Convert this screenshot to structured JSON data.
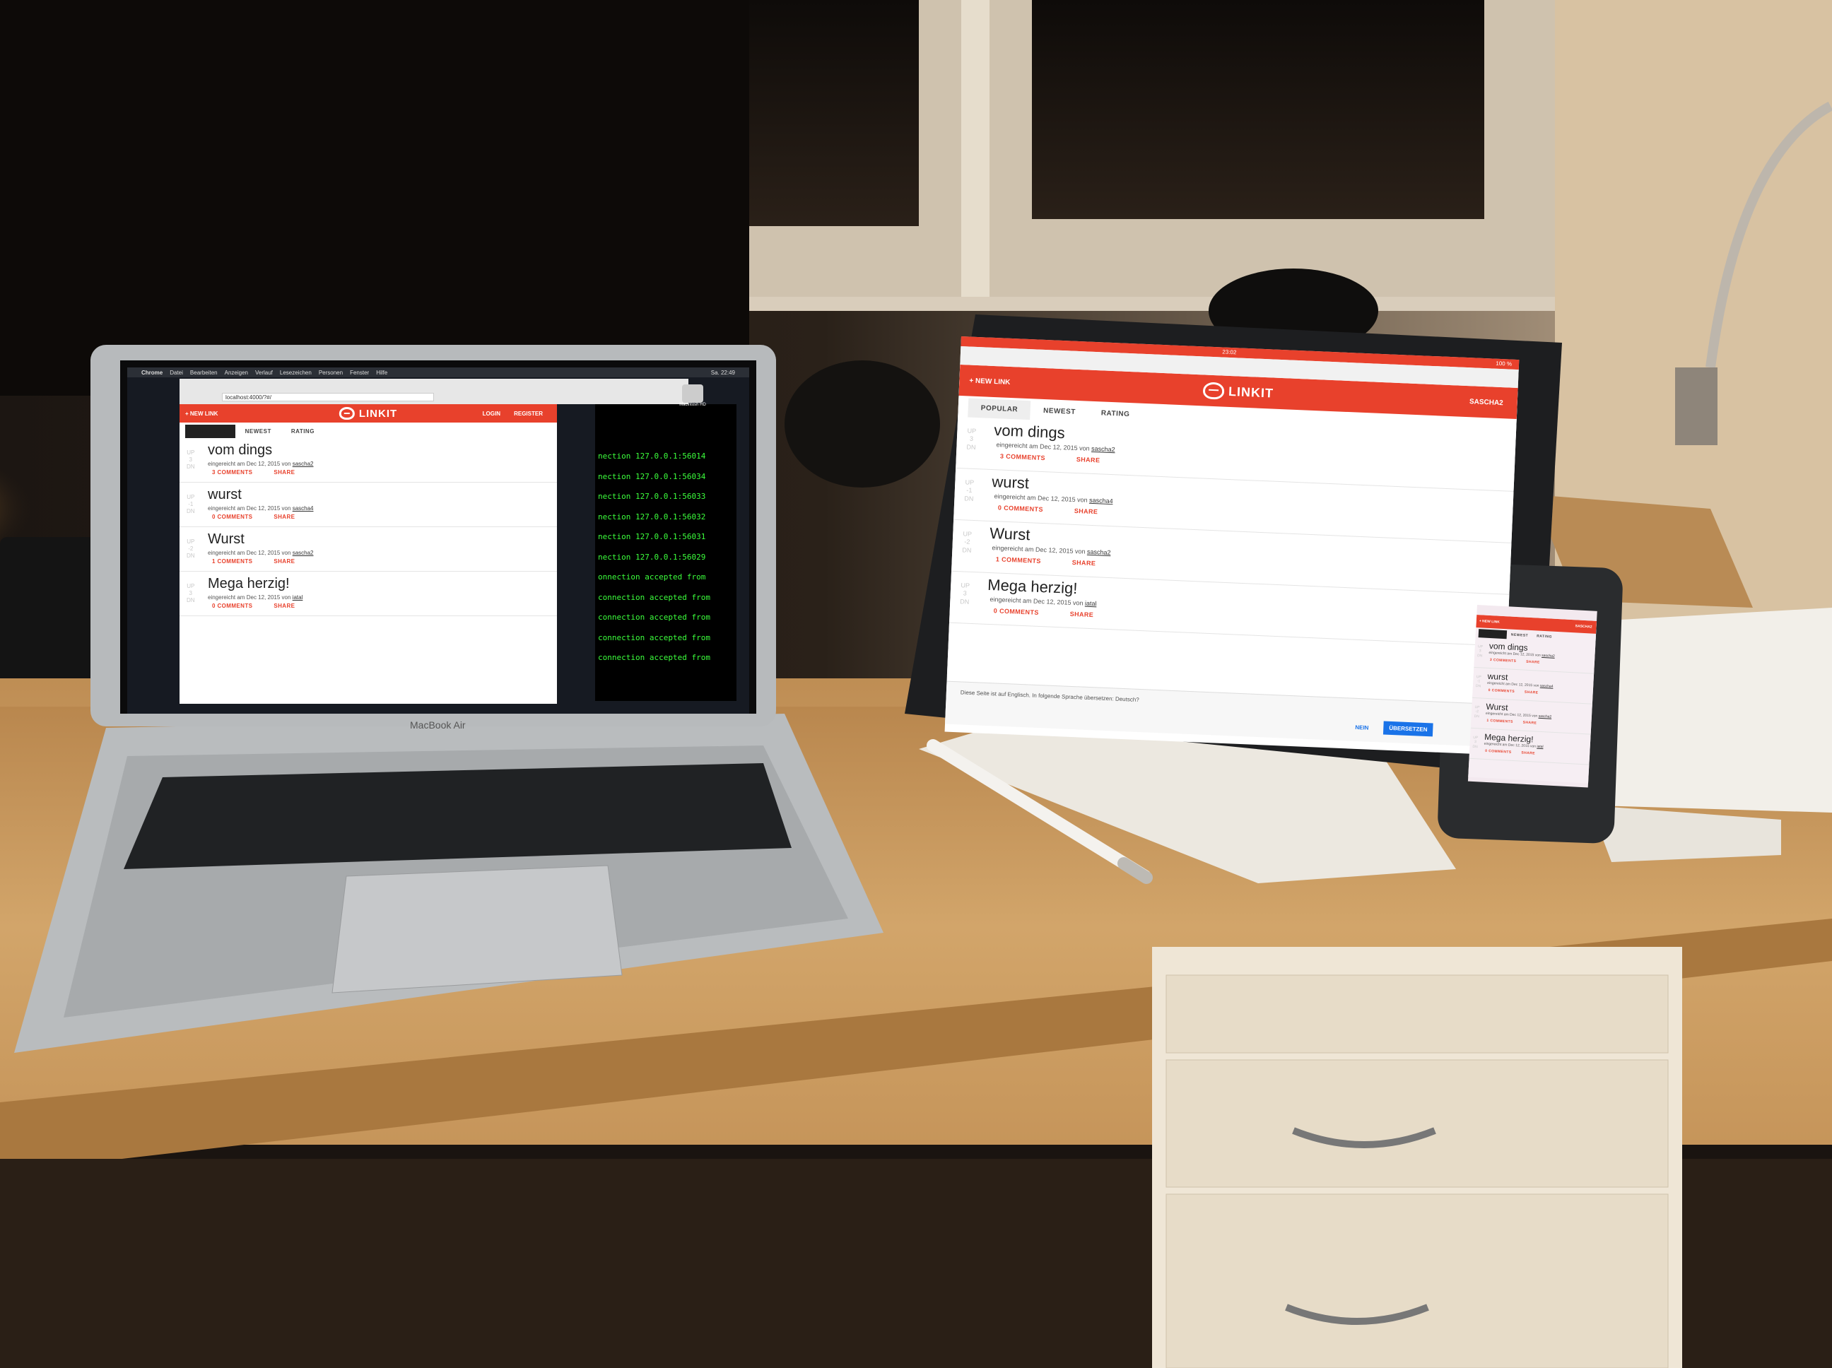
{
  "app": {
    "brand": "LINKIT",
    "new_link": "+ NEW LINK",
    "login": "LOGIN",
    "register": "REGISTER",
    "user": "SASCHA2",
    "tabs": [
      "POPULAR",
      "NEWEST",
      "RATING"
    ],
    "up": "UP",
    "down": "DN",
    "comments_suffix": "COMMENTS",
    "share": "SHARE",
    "submitted_prefix": "eingereicht am",
    "by": "von",
    "posts": [
      {
        "title": "vom dings",
        "score": "3",
        "date": "Dec 12, 2015",
        "user": "sascha2",
        "comments": "3"
      },
      {
        "title": "wurst",
        "score": "-1",
        "date": "Dec 12, 2015",
        "user": "sascha4",
        "comments": "0"
      },
      {
        "title": "Wurst",
        "score": "-2",
        "date": "Dec 12, 2015",
        "user": "sascha2",
        "comments": "1"
      },
      {
        "title": "Mega herzig!",
        "score": "3",
        "date": "Dec 12, 2015",
        "user": "iatal",
        "comments": "0"
      }
    ]
  },
  "laptop": {
    "brand_label": "MacBook Air",
    "address": "localhost:4000/?#/",
    "menu": [
      "Chrome",
      "Datei",
      "Bearbeiten",
      "Anzeigen",
      "Verlauf",
      "Lesezeichen",
      "Personen",
      "Fenster",
      "Hilfe"
    ],
    "clock": "Sa. 22:49",
    "terminal_lines": [
      "nection 127.0.0.1:56014",
      "nection 127.0.0.1:56034",
      "nection 127.0.0.1:56033",
      "nection 127.0.0.1:56032",
      "nection 127.0.0.1:56031",
      "nection 127.0.0.1:56029",
      "onnection accepted from",
      "connection accepted from",
      "connection accepted from",
      "connection accepted from",
      "connection accepted from"
    ],
    "desktop_icons": [
      "Macintosh HD"
    ]
  },
  "tablet": {
    "clock": "23:02",
    "battery": "100 %",
    "translate_prompt": "Diese Seite ist auf Englisch. In folgende Sprache übersetzen: Deutsch?",
    "translate_no": "NEIN",
    "translate_yes": "ÜBERSETZEN"
  },
  "colors": {
    "accent": "#e8412c",
    "terminal_green": "#3cff3c",
    "desk": "#c99b5f"
  }
}
